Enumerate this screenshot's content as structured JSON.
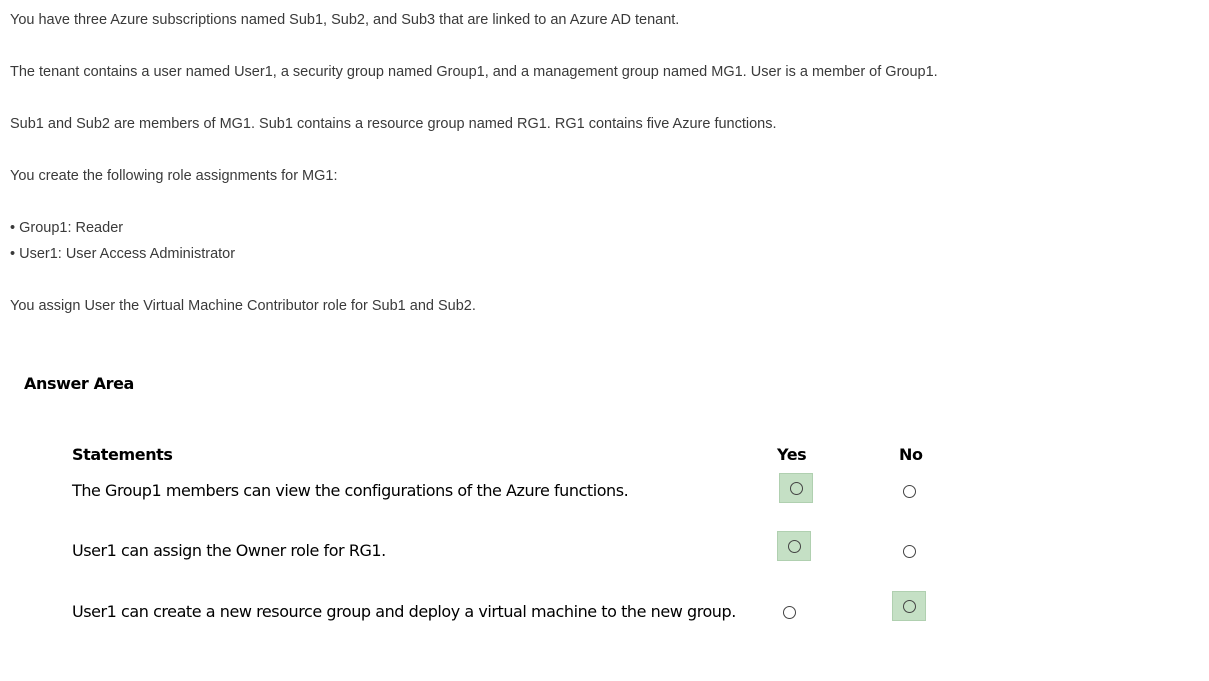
{
  "question": {
    "lines": [
      "You have three Azure subscriptions named Sub1, Sub2, and Sub3 that are linked to an Azure AD tenant.",
      "The tenant contains a user named User1, a security group named Group1, and a management group named MG1. User is a member of Group1.",
      "Sub1 and Sub2 are members of MG1. Sub1 contains a resource group named RG1. RG1 contains five Azure functions.",
      "You create the following role assignments for MG1:",
      "• Group1: Reader",
      "• User1: User Access Administrator",
      "You assign User the Virtual Machine Contributor role for Sub1 and Sub2."
    ]
  },
  "answer_area": {
    "title": "Answer Area",
    "headers": {
      "statements": "Statements",
      "yes": "Yes",
      "no": "No"
    },
    "statements": [
      {
        "text": "The Group1 members can view the configurations of the Azure functions.",
        "selected": "yes"
      },
      {
        "text": "User1 can assign the Owner role for RG1.",
        "selected": "yes"
      },
      {
        "text": "User1 can create a new resource group and deploy a virtual machine to the new group.",
        "selected": "no"
      }
    ]
  },
  "colors": {
    "selection_highlight": "#c5e0c5"
  }
}
